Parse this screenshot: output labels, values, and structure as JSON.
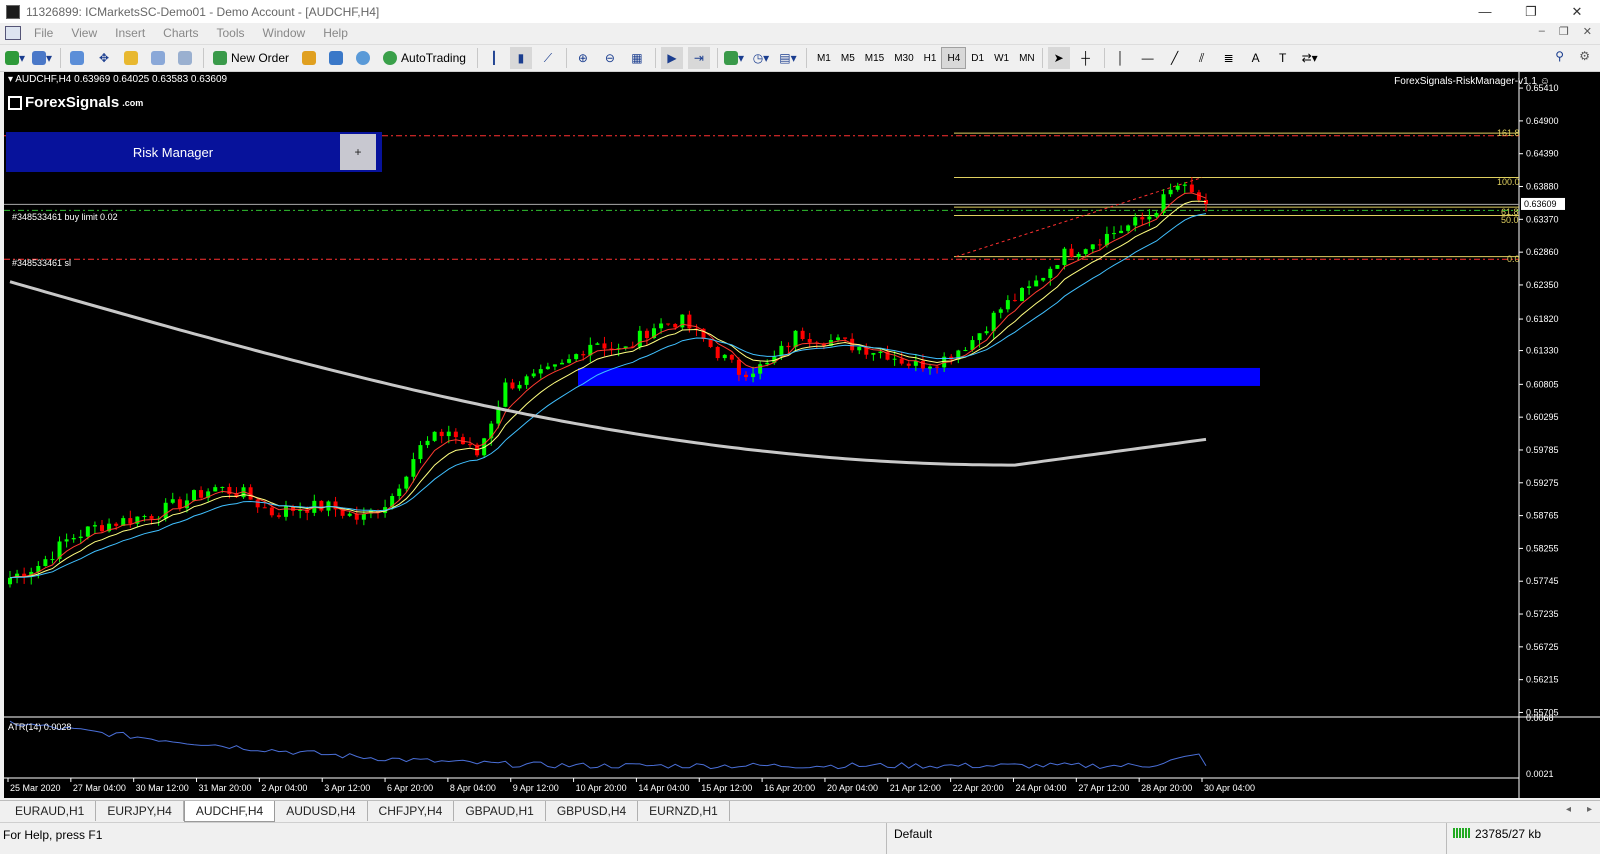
{
  "window": {
    "title": "11326899: ICMarketsSC-Demo01 - Demo Account - [AUDCHF,H4]"
  },
  "menu": [
    "File",
    "View",
    "Insert",
    "Charts",
    "Tools",
    "Window",
    "Help"
  ],
  "toolbar": {
    "new_order": "New Order",
    "autotrading": "AutoTrading",
    "timeframes": [
      "M1",
      "M5",
      "M15",
      "M30",
      "H1",
      "H4",
      "D1",
      "W1",
      "MN"
    ],
    "active_timeframe": "H4"
  },
  "chart": {
    "header": "AUDCHF,H4  0.63969 0.64025 0.63583 0.63609",
    "ea_label": "ForexSignals-RiskManager-v1.1",
    "logo": "ForexSignals",
    "logo_suffix": ".com",
    "risk_panel": {
      "title": "Risk Manager",
      "plus": "+"
    },
    "orders": {
      "buy_limit": "#348533461 buy limit 0.02",
      "sl": "#348533461 sl"
    },
    "fib_levels": [
      {
        "label": "161.8",
        "price": 0.6471
      },
      {
        "label": "100.0",
        "price": 0.6402
      },
      {
        "label": "61.8",
        "price": 0.6356
      },
      {
        "label": "50.0",
        "price": 0.6343
      },
      {
        "label": "0.0",
        "price": 0.6279
      }
    ],
    "current_price": "0.63609",
    "atr_label": "ATR(14) 0.0028",
    "colors": {
      "bull": "#00ff00",
      "bear": "#ff0000",
      "zone": "#0000ff",
      "sma200": "#c8c8c8",
      "ema_fast": "#ff3b30",
      "ema_mid": "#ffff80",
      "ema_slow": "#40c0ff",
      "fib": "#e0d060",
      "atr": "#4a6fd8"
    }
  },
  "chart_data": {
    "type": "candlestick",
    "symbol": "AUDCHF",
    "timeframe": "H4",
    "ylim": [
      0.5565,
      0.6566
    ],
    "yticks": [
      "0.65410",
      "0.64900",
      "0.64390",
      "0.63880",
      "0.63370",
      "0.62860",
      "0.62350",
      "0.61820",
      "0.61330",
      "0.60805",
      "0.60295",
      "0.59785",
      "0.59275",
      "0.58765",
      "0.58255",
      "0.57745",
      "0.57235",
      "0.56725",
      "0.56215",
      "0.55705"
    ],
    "xticks": [
      "25 Mar 2020",
      "27 Mar 04:00",
      "30 Mar 12:00",
      "31 Mar 20:00",
      "2 Apr 04:00",
      "3 Apr 12:00",
      "6 Apr 20:00",
      "8 Apr 04:00",
      "9 Apr 12:00",
      "10 Apr 20:00",
      "14 Apr 04:00",
      "15 Apr 12:00",
      "16 Apr 20:00",
      "20 Apr 04:00",
      "21 Apr 12:00",
      "22 Apr 20:00",
      "24 Apr 04:00",
      "27 Apr 12:00",
      "28 Apr 20:00",
      "30 Apr 04:00"
    ],
    "close_path": [
      0.578,
      0.58,
      0.584,
      0.586,
      0.587,
      0.588,
      0.59,
      0.592,
      0.591,
      0.588,
      0.589,
      0.589,
      0.587,
      0.59,
      0.598,
      0.601,
      0.597,
      0.608,
      0.609,
      0.611,
      0.615,
      0.613,
      0.617,
      0.618,
      0.614,
      0.61,
      0.611,
      0.616,
      0.615,
      0.614,
      0.613,
      0.611,
      0.612,
      0.615,
      0.62,
      0.623,
      0.628,
      0.63,
      0.632,
      0.634,
      0.639,
      0.6361
    ],
    "demand_zone": [
      0.6078,
      0.6106
    ],
    "orders": {
      "buy_limit": 0.6351,
      "stop_loss": 0.6275,
      "level_upper": 0.6467
    },
    "atr": {
      "period": 14,
      "value": 0.0028,
      "ylim": [
        0.0021,
        0.0068
      ]
    }
  },
  "tabs": [
    "EURAUD,H1",
    "EURJPY,H4",
    "AUDCHF,H4",
    "AUDUSD,H4",
    "CHFJPY,H4",
    "GBPAUD,H1",
    "GBPUSD,H4",
    "EURNZD,H1"
  ],
  "active_tab": "AUDCHF,H4",
  "status": {
    "help": "For Help, press F1",
    "profile": "Default",
    "traffic": "23785/27 kb"
  }
}
